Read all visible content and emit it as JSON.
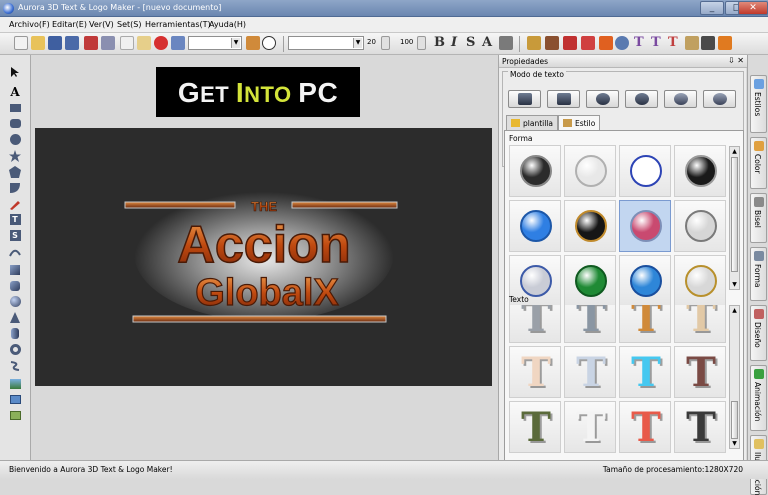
{
  "window": {
    "title": "Aurora 3D Text & Logo Maker - [nuevo documento]",
    "min": "_",
    "max": "□",
    "close": "✕"
  },
  "menu": [
    "Archivo(F)",
    "Editar(E)",
    "Ver(V)",
    "Set(S)",
    "Herramientas(T)",
    "Ayuda(H)"
  ],
  "toolbar": {
    "size_value": "20",
    "zoom_value": "100",
    "bold": "B",
    "italic": "I",
    "strike": "S",
    "outline": "A",
    "text_icons": [
      "T",
      "T",
      "T"
    ]
  },
  "watermark": {
    "get": "G",
    "get_rest": "ET ",
    "into": "I",
    "into_rest": "NTO ",
    "pc": "PC"
  },
  "canvas_text": {
    "small": "THE",
    "line1": "Accion",
    "line2": "GlobalX"
  },
  "panel": {
    "title": "Propiedades",
    "head_buttons": "⇩ ✕",
    "text_mode_label": "Modo de texto",
    "tabs": [
      "plantilla",
      "Estilo"
    ],
    "section_shape": "Forma",
    "section_text": "Texto"
  },
  "shape_swatches": [
    {
      "color": "#2b2b2b",
      "rim": "#888888"
    },
    {
      "color": "#e8e8e8",
      "rim": "#b0b0b0"
    },
    {
      "color": "#ffffff",
      "rim": "#2d44b5"
    },
    {
      "color": "#1a1a1a",
      "rim": "#9a9a9a"
    },
    {
      "color": "#2f7fe3",
      "rim": "#1c57a8"
    },
    {
      "color": "#161616",
      "rim": "#c08a2c"
    },
    {
      "color": "#c94a70",
      "rim": "#7d8fb7"
    },
    {
      "color": "#d6d6d6",
      "rim": "#7a7a7a"
    },
    {
      "color": "#c9ccd6",
      "rim": "#3c5aa8"
    },
    {
      "color": "#1f8a35",
      "rim": "#0f5a20"
    },
    {
      "color": "#2e86d8",
      "rim": "#1a4f9e"
    },
    {
      "color": "#d8d8d8",
      "rim": "#b8902c"
    }
  ],
  "text_swatches": [
    {
      "glyph": "T",
      "color": "#9aa0a8"
    },
    {
      "glyph": "T",
      "color": "#8a96a3"
    },
    {
      "glyph": "T",
      "color": "#d08a3a"
    },
    {
      "glyph": "T",
      "color": "#e2c9a6"
    },
    {
      "glyph": "T",
      "color": "#f0d6c2"
    },
    {
      "glyph": "T",
      "color": "#c9d4e4"
    },
    {
      "glyph": "T",
      "color": "#45c8f0"
    },
    {
      "glyph": "T",
      "color": "#7a4a44"
    },
    {
      "glyph": "T",
      "color": "#5a6a3a"
    },
    {
      "glyph": "T",
      "color": "#f4f4f4"
    },
    {
      "glyph": "T",
      "color": "#e85a4a"
    },
    {
      "glyph": "T",
      "color": "#3a3a3a"
    }
  ],
  "side_tabs": [
    {
      "label": "Estilos",
      "icon_color": "#6aa0e0"
    },
    {
      "label": "Color",
      "icon_color": "#e0a040"
    },
    {
      "label": "Bisel",
      "icon_color": "#8a8a8a"
    },
    {
      "label": "Forma",
      "icon_color": "#7a8aa0"
    },
    {
      "label": "Diseño",
      "icon_color": "#c06060"
    },
    {
      "label": "Animación",
      "icon_color": "#3aa040"
    },
    {
      "label": "Iluminación",
      "icon_color": "#e0c060"
    }
  ],
  "status": {
    "left": "Bienvenido a Aurora 3D Text & Logo Maker!",
    "right": "Tamaño de procesamiento:1280X720"
  }
}
